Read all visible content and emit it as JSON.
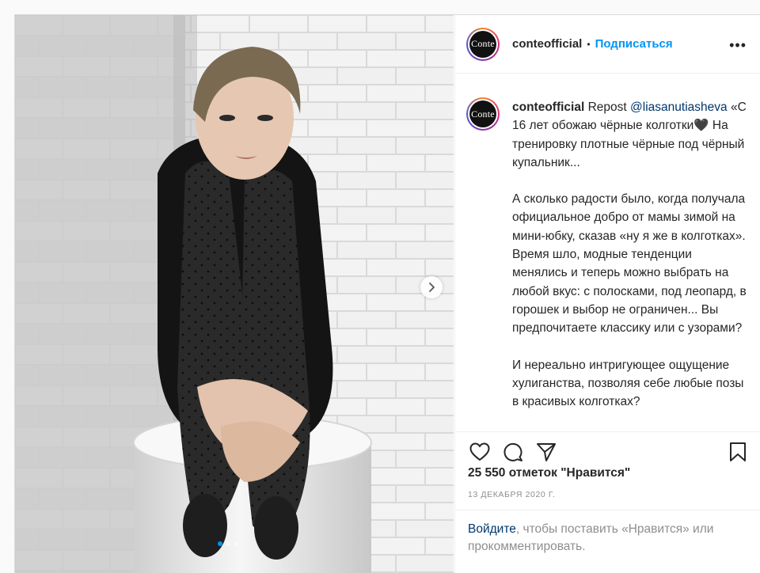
{
  "post": {
    "username": "conteofficial",
    "follow_label": "Подписаться",
    "separator": "•",
    "more_label": "•••",
    "avatar_text": "Conte"
  },
  "caption": {
    "username": "conteofficial",
    "prefix": "Repost",
    "mention": "@liasanutiasheva",
    "paragraph1": "«С 16 лет обожаю чёрные колготки🖤 На тренировку плотные чёрные под чёрный купальник...",
    "paragraph2": "А сколько радости было, когда получала официальное добро от мамы зимой на мини-юбку, сказав «ну я же в колготках». Время шло, модные тенденции менялись и теперь можно выбрать на любой вкус: с полосками, под леопард, в горошек и выбор не ограничен... Вы предпочитаете классику или с узорами?",
    "paragraph3": "И нереально интригующее ощущение хулиганства, позволяя себе любые позы в красивых колготках?"
  },
  "actions": {
    "like_icon": "heart-icon",
    "comment_icon": "comment-icon",
    "share_icon": "paper-plane-icon",
    "save_icon": "bookmark-icon"
  },
  "likes_text": "25 550 отметок \"Нравится\"",
  "date_text": "13 ДЕКАБРЯ 2020 Г.",
  "login_prompt": {
    "link": "Войдите",
    "rest": ", чтобы поставить «Нравится» или прокомментировать."
  },
  "carousel": {
    "next_icon": "chevron-right-icon",
    "slide_count": 3,
    "active_slide": 1
  },
  "colors": {
    "accent": "#0095f6",
    "link_dark": "#00376b",
    "muted": "#8e8e8e",
    "text": "#262626"
  }
}
